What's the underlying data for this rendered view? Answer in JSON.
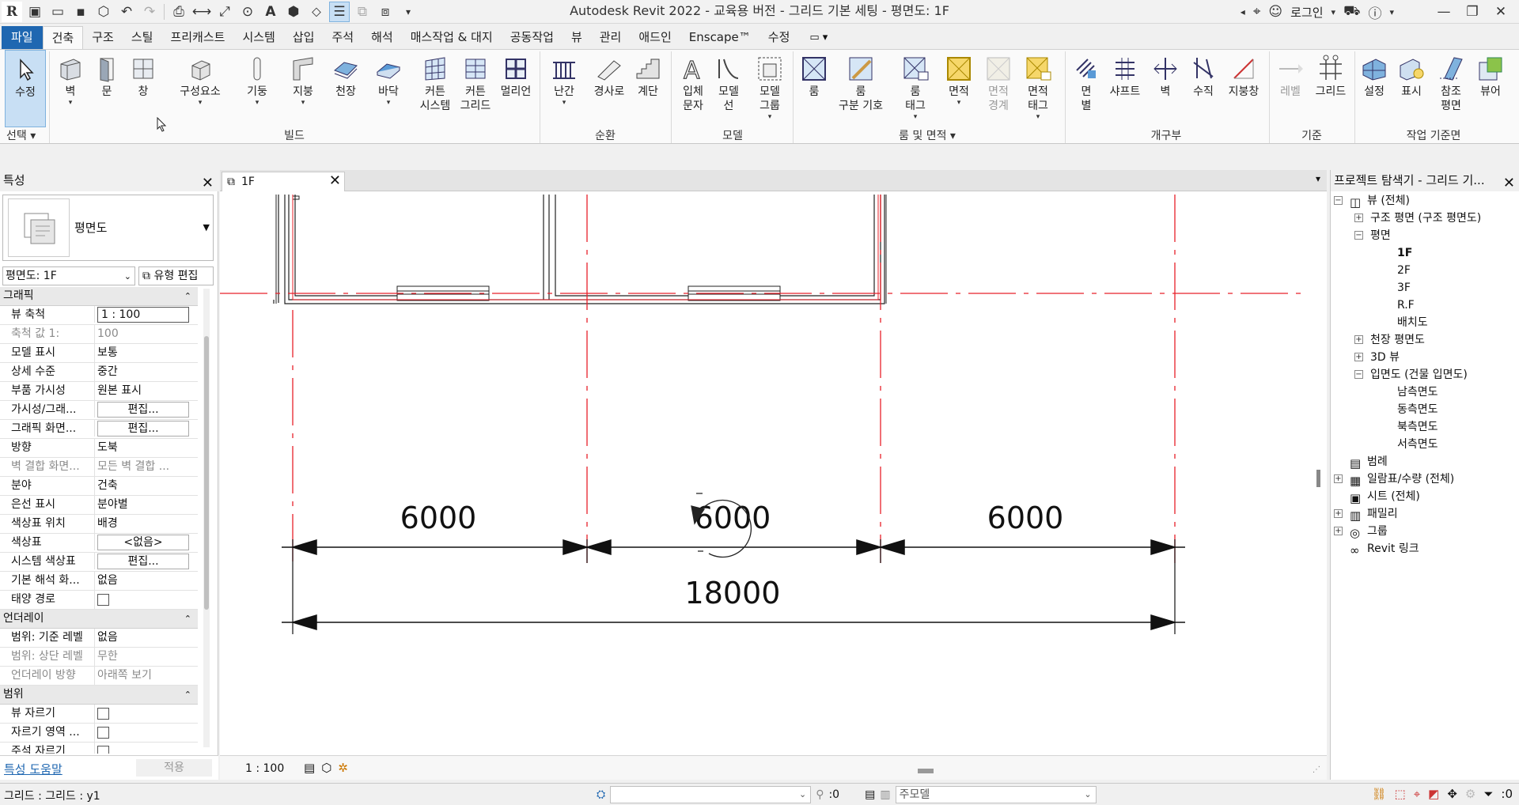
{
  "app": {
    "title": "Autodesk Revit 2022 - 교육용 버전 - 그리드 기본 세팅 - 평면도: 1F",
    "logo": "R",
    "login": "로그인"
  },
  "menu_tabs": [
    "파일",
    "건축",
    "구조",
    "스틸",
    "프리캐스트",
    "시스템",
    "삽입",
    "주석",
    "해석",
    "매스작업 & 대지",
    "공동작업",
    "뷰",
    "관리",
    "애드인",
    "Enscape™",
    "수정"
  ],
  "ribbon": {
    "modify": "수정",
    "select_panel": "선택",
    "build": [
      "벽",
      "문",
      "창",
      "구성요소",
      "기둥",
      "지붕",
      "천장",
      "바닥",
      "커튼\n시스템",
      "커튼\n그리드",
      "멀리언"
    ],
    "build_panel": "빌드",
    "circulation": [
      "난간",
      "경사로",
      "계단"
    ],
    "circulation_panel": "순환",
    "model": [
      "입체\n문자",
      "모델\n선",
      "모델\n그룹"
    ],
    "model_panel": "모델",
    "room": [
      "룸",
      "룸\n구분 기호",
      "룸\n태그",
      "면적",
      "면적\n경계",
      "면적\n태그"
    ],
    "room_panel": "룸 및 면적",
    "opening": [
      "면\n별",
      "샤프트",
      "벽",
      "수직",
      "지붕창"
    ],
    "opening_panel": "개구부",
    "datum": [
      "레벨",
      "그리드"
    ],
    "datum_panel": "기준",
    "workplane": [
      "설정",
      "표시",
      "참조\n평면",
      "뷰어"
    ],
    "workplane_panel": "작업 기준면"
  },
  "properties": {
    "header": "특성",
    "type_name": "평면도",
    "instance": "평면도: 1F",
    "edit_type": "유형 편집",
    "rows": [
      {
        "kind": "section",
        "label": "그래픽"
      },
      {
        "label": "뷰 축척",
        "value": "1 : 100",
        "style": "input"
      },
      {
        "label": "축척 값    1:",
        "value": "100",
        "style": "grey"
      },
      {
        "label": "모델 표시",
        "value": "보통"
      },
      {
        "label": "상세 수준",
        "value": "중간"
      },
      {
        "label": "부품 가시성",
        "value": "원본 표시"
      },
      {
        "label": "가시성/그래...",
        "value": "편집...",
        "style": "button"
      },
      {
        "label": "그래픽 화면...",
        "value": "편집...",
        "style": "button"
      },
      {
        "label": "방향",
        "value": "도북"
      },
      {
        "label": "벽 결합 화면...",
        "value": "모든 벽 결합 ...",
        "style": "grey"
      },
      {
        "label": "분야",
        "value": "건축"
      },
      {
        "label": "은선 표시",
        "value": "분야별"
      },
      {
        "label": "색상표 위치",
        "value": "배경"
      },
      {
        "label": "색상표",
        "value": "<없음>",
        "style": "button"
      },
      {
        "label": "시스템 색상표",
        "value": "편집...",
        "style": "button"
      },
      {
        "label": "기본 해석 화...",
        "value": "없음"
      },
      {
        "label": "태양 경로",
        "value": "",
        "style": "checkbox"
      },
      {
        "kind": "section",
        "label": "언더레이"
      },
      {
        "label": "범위: 기준 레벨",
        "value": "없음"
      },
      {
        "label": "범위: 상단 레벨",
        "value": "무한",
        "style": "grey"
      },
      {
        "label": "언더레이 방향",
        "value": "아래쪽 보기",
        "style": "grey"
      },
      {
        "kind": "section",
        "label": "범위"
      },
      {
        "label": "뷰 자르기",
        "value": "",
        "style": "checkbox"
      },
      {
        "label": "자르기 영역 ...",
        "value": "",
        "style": "checkbox"
      },
      {
        "label": "주석 자르기",
        "value": "",
        "style": "checkbox"
      }
    ],
    "help": "특성 도움말",
    "apply": "적용"
  },
  "view": {
    "tab": "1F",
    "scale": "1 : 100",
    "dims": [
      "6000",
      "6000",
      "6000"
    ],
    "total_dim": "18000"
  },
  "browser": {
    "header": "프로젝트 탐색기 - 그리드 기...",
    "tree": [
      {
        "label": "뷰 (전체)",
        "level": 0,
        "toggle": "−",
        "icon": "◫"
      },
      {
        "label": "구조 평면 (구조 평면도)",
        "level": 1,
        "toggle": "+"
      },
      {
        "label": "평면",
        "level": 1,
        "toggle": "−"
      },
      {
        "label": "1F",
        "level": 2,
        "bold": true
      },
      {
        "label": "2F",
        "level": 2
      },
      {
        "label": "3F",
        "level": 2
      },
      {
        "label": "R.F",
        "level": 2
      },
      {
        "label": "배치도",
        "level": 2
      },
      {
        "label": "천장 평면도",
        "level": 1,
        "toggle": "+"
      },
      {
        "label": "3D 뷰",
        "level": 1,
        "toggle": "+"
      },
      {
        "label": "입면도 (건물 입면도)",
        "level": 1,
        "toggle": "−"
      },
      {
        "label": "남측면도",
        "level": 2
      },
      {
        "label": "동측면도",
        "level": 2
      },
      {
        "label": "북측면도",
        "level": 2
      },
      {
        "label": "서측면도",
        "level": 2
      },
      {
        "label": "범례",
        "level": 0,
        "icon": "▤"
      },
      {
        "label": "일람표/수량 (전체)",
        "level": 0,
        "toggle": "+",
        "icon": "▦"
      },
      {
        "label": "시트 (전체)",
        "level": 0,
        "icon": "▣"
      },
      {
        "label": "패밀리",
        "level": 0,
        "toggle": "+",
        "icon": "▥"
      },
      {
        "label": "그룹",
        "level": 0,
        "toggle": "+",
        "icon": "◎"
      },
      {
        "label": "Revit 링크",
        "level": 0,
        "icon": "∞"
      }
    ]
  },
  "status": {
    "text": "그리드 : 그리드 : y1",
    "zero1": ":0",
    "model": "주모델",
    "zero2": ":0"
  },
  "colors": {
    "file_tab": "#1f67b1",
    "grid_red": "#e8202a",
    "modify_bg": "#c8dff4"
  }
}
